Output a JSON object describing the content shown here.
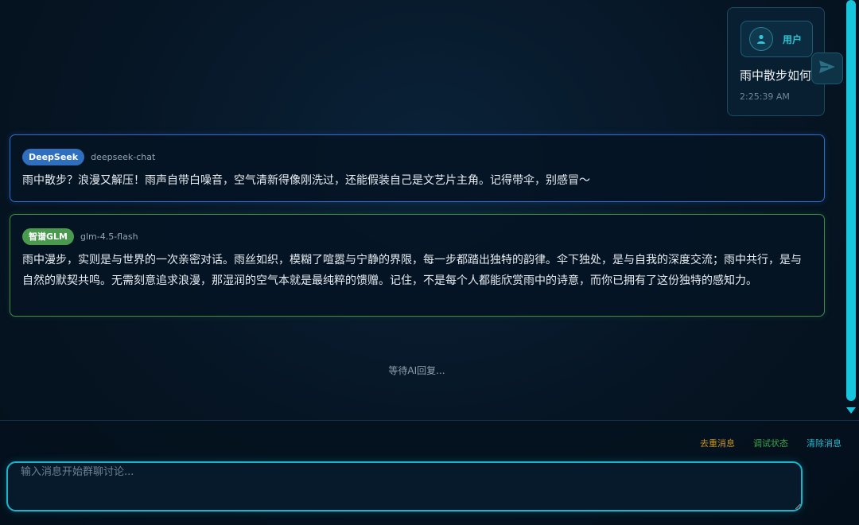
{
  "user_message": {
    "role_label": "用户",
    "text": "雨中散步如何",
    "time": "2:25:39 AM"
  },
  "ai_messages": [
    {
      "provider": "DeepSeek",
      "model": "deepseek-chat",
      "text": "雨中散步？浪漫又解压！雨声自带白噪音，空气清新得像刚洗过，还能假装自己是文艺片主角。记得带伞，别感冒～",
      "accent": "#2a6fcd"
    },
    {
      "provider": "智谱GLM",
      "model": "glm-4.5-flash",
      "text": "雨中漫步，实则是与世界的一次亲密对话。雨丝如织，模糊了喧嚣与宁静的界限，每一步都踏出独特的韵律。伞下独处，是与自我的深度交流；雨中共行，是与自然的默契共鸣。无需刻意追求浪漫，那湿润的空气本就是最纯粹的馈赠。记住，不是每个人都能欣赏雨中的诗意，而你已拥有了这份独特的感知力。",
      "accent": "#3f8e43"
    }
  ],
  "status": {
    "waiting": "等待AI回复..."
  },
  "actions": {
    "dedup": "去重消息",
    "debug": "调试状态",
    "clear": "清除消息"
  },
  "input": {
    "placeholder": "输入消息开始群聊讨论...",
    "value": ""
  },
  "colors": {
    "accent_cyan": "#17c5dc",
    "background": "#061524"
  },
  "icons": {
    "avatar": "user-icon",
    "send": "paper-plane-icon"
  }
}
